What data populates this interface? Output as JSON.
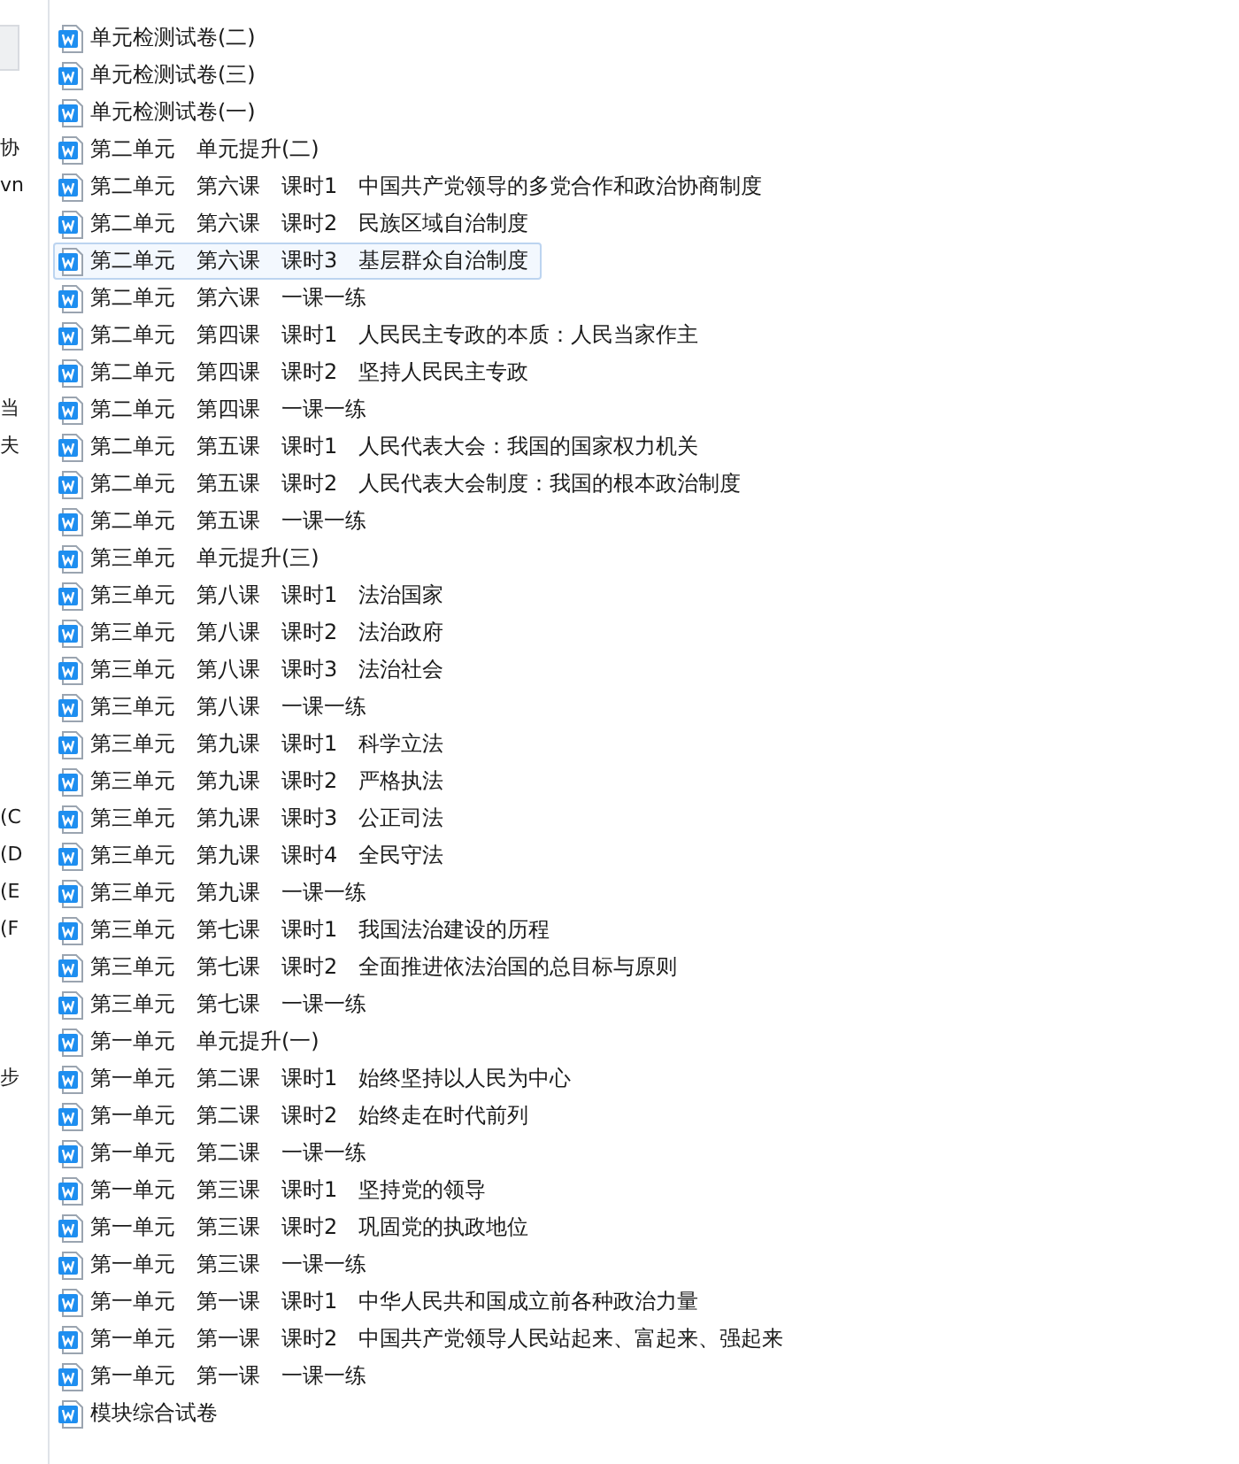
{
  "side_panel": {
    "fragments": [
      "协",
      "vn",
      "当",
      "夫",
      "(C",
      "(D",
      "(E",
      "(F",
      "步"
    ]
  },
  "files": [
    {
      "name": "单元检测试卷(二)",
      "selected": false
    },
    {
      "name": "单元检测试卷(三)",
      "selected": false
    },
    {
      "name": "单元检测试卷(一)",
      "selected": false
    },
    {
      "name": "第二单元　单元提升(二)",
      "selected": false
    },
    {
      "name": "第二单元　第六课　课时1　中国共产党领导的多党合作和政治协商制度",
      "selected": false
    },
    {
      "name": "第二单元　第六课　课时2　民族区域自治制度",
      "selected": false
    },
    {
      "name": "第二单元　第六课　课时3　基层群众自治制度",
      "selected": true
    },
    {
      "name": "第二单元　第六课　一课一练",
      "selected": false
    },
    {
      "name": "第二单元　第四课　课时1　人民民主专政的本质：人民当家作主",
      "selected": false
    },
    {
      "name": "第二单元　第四课　课时2　坚持人民民主专政",
      "selected": false
    },
    {
      "name": "第二单元　第四课　一课一练",
      "selected": false
    },
    {
      "name": "第二单元　第五课　课时1　人民代表大会：我国的国家权力机关",
      "selected": false
    },
    {
      "name": "第二单元　第五课　课时2　人民代表大会制度：我国的根本政治制度",
      "selected": false
    },
    {
      "name": "第二单元　第五课　一课一练",
      "selected": false
    },
    {
      "name": "第三单元　单元提升(三)",
      "selected": false
    },
    {
      "name": "第三单元　第八课　课时1　法治国家",
      "selected": false
    },
    {
      "name": "第三单元　第八课　课时2　法治政府",
      "selected": false
    },
    {
      "name": "第三单元　第八课　课时3　法治社会",
      "selected": false
    },
    {
      "name": "第三单元　第八课　一课一练",
      "selected": false
    },
    {
      "name": "第三单元　第九课　课时1　科学立法",
      "selected": false
    },
    {
      "name": "第三单元　第九课　课时2　严格执法",
      "selected": false
    },
    {
      "name": "第三单元　第九课　课时3　公正司法",
      "selected": false
    },
    {
      "name": "第三单元　第九课　课时4　全民守法",
      "selected": false
    },
    {
      "name": "第三单元　第九课　一课一练",
      "selected": false
    },
    {
      "name": "第三单元　第七课　课时1　我国法治建设的历程",
      "selected": false
    },
    {
      "name": "第三单元　第七课　课时2　全面推进依法治国的总目标与原则",
      "selected": false
    },
    {
      "name": "第三单元　第七课　一课一练",
      "selected": false
    },
    {
      "name": "第一单元　单元提升(一)",
      "selected": false
    },
    {
      "name": "第一单元　第二课　课时1　始终坚持以人民为中心",
      "selected": false
    },
    {
      "name": "第一单元　第二课　课时2　始终走在时代前列",
      "selected": false
    },
    {
      "name": "第一单元　第二课　一课一练",
      "selected": false
    },
    {
      "name": "第一单元　第三课　课时1　坚持党的领导",
      "selected": false
    },
    {
      "name": "第一单元　第三课　课时2　巩固党的执政地位",
      "selected": false
    },
    {
      "name": "第一单元　第三课　一课一练",
      "selected": false
    },
    {
      "name": "第一单元　第一课　课时1　中华人民共和国成立前各种政治力量",
      "selected": false
    },
    {
      "name": "第一单元　第一课　课时2　中国共产党领导人民站起来、富起来、强起来",
      "selected": false
    },
    {
      "name": "第一单元　第一课　一课一练",
      "selected": false
    },
    {
      "name": "模块综合试卷",
      "selected": false
    }
  ]
}
